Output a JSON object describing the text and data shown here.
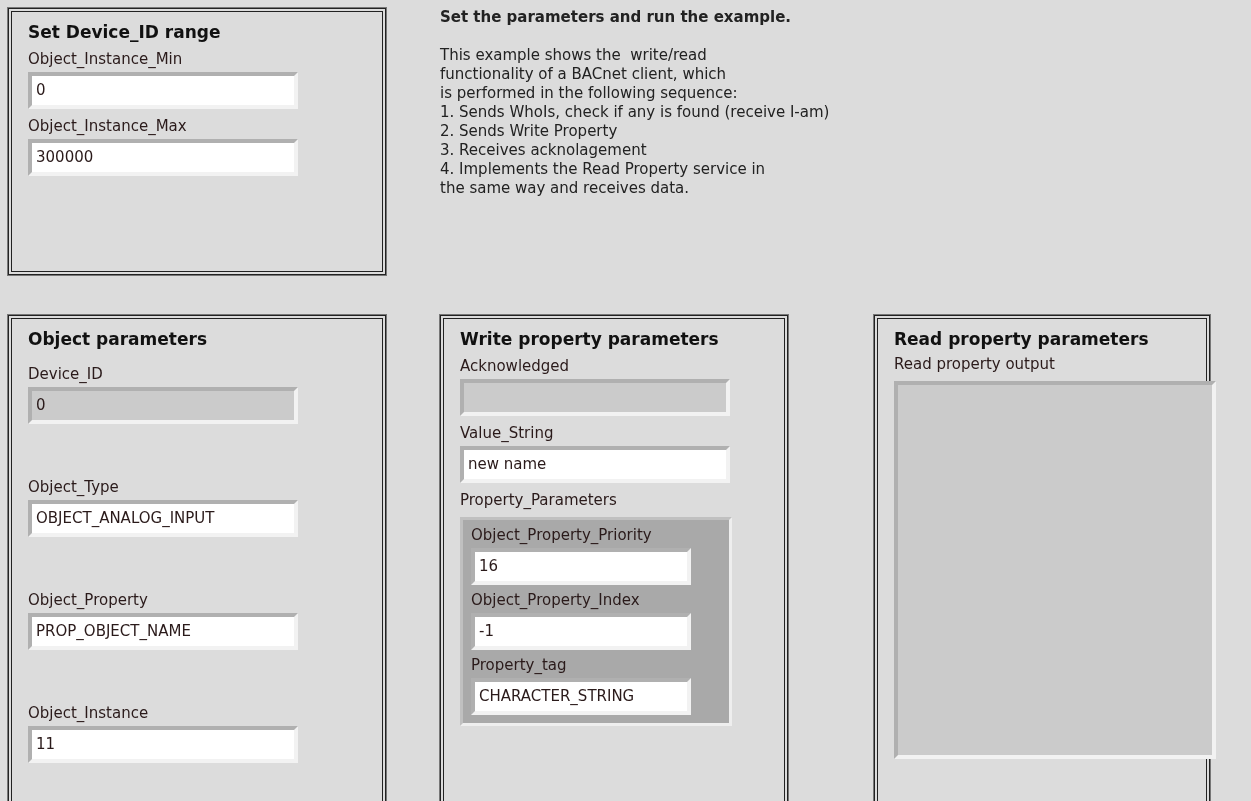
{
  "range_panel": {
    "title": "Set Device_ID range",
    "fields": [
      {
        "label": "Object_Instance_Min",
        "value": "0",
        "kind": "control"
      },
      {
        "label": "Object_Instance_Max",
        "value": "300000",
        "kind": "control"
      }
    ]
  },
  "description": {
    "title": "Set the parameters and run the example.",
    "lines": [
      "This example shows the  write/read",
      "functionality of a BACnet client, which",
      "is performed in the following sequence:",
      "1. Sends WhoIs, check if any is found (receive I-am)",
      "2. Sends Write Property",
      "3. Receives acknolagement",
      "4. Implements the Read Property service in",
      "the same way and receives data."
    ]
  },
  "object_panel": {
    "title": "Object parameters",
    "fields": [
      {
        "label": "Device_ID",
        "value": "0",
        "kind": "indicator"
      },
      {
        "label": "Object_Type",
        "value": "OBJECT_ANALOG_INPUT",
        "kind": "control"
      },
      {
        "label": "Object_Property",
        "value": "PROP_OBJECT_NAME",
        "kind": "control"
      },
      {
        "label": "Object_Instance",
        "value": "11",
        "kind": "control"
      }
    ]
  },
  "write_panel": {
    "title": "Write property parameters",
    "fields": [
      {
        "label": "Acknowledged",
        "kind": "indicator"
      },
      {
        "label": "Value_String",
        "value": "new name",
        "kind": "control"
      }
    ],
    "cluster": {
      "label": "Property_Parameters",
      "fields": [
        {
          "label": "Object_Property_Priority",
          "value": "16",
          "kind": "control"
        },
        {
          "label": "Object_Property_Index",
          "value": "-1",
          "kind": "control"
        },
        {
          "label": "Property_tag",
          "value": "CHARACTER_STRING",
          "kind": "control"
        }
      ]
    }
  },
  "read_panel": {
    "title": "Read property parameters",
    "output": {
      "label": "Read property output",
      "kind": "indicator"
    }
  }
}
